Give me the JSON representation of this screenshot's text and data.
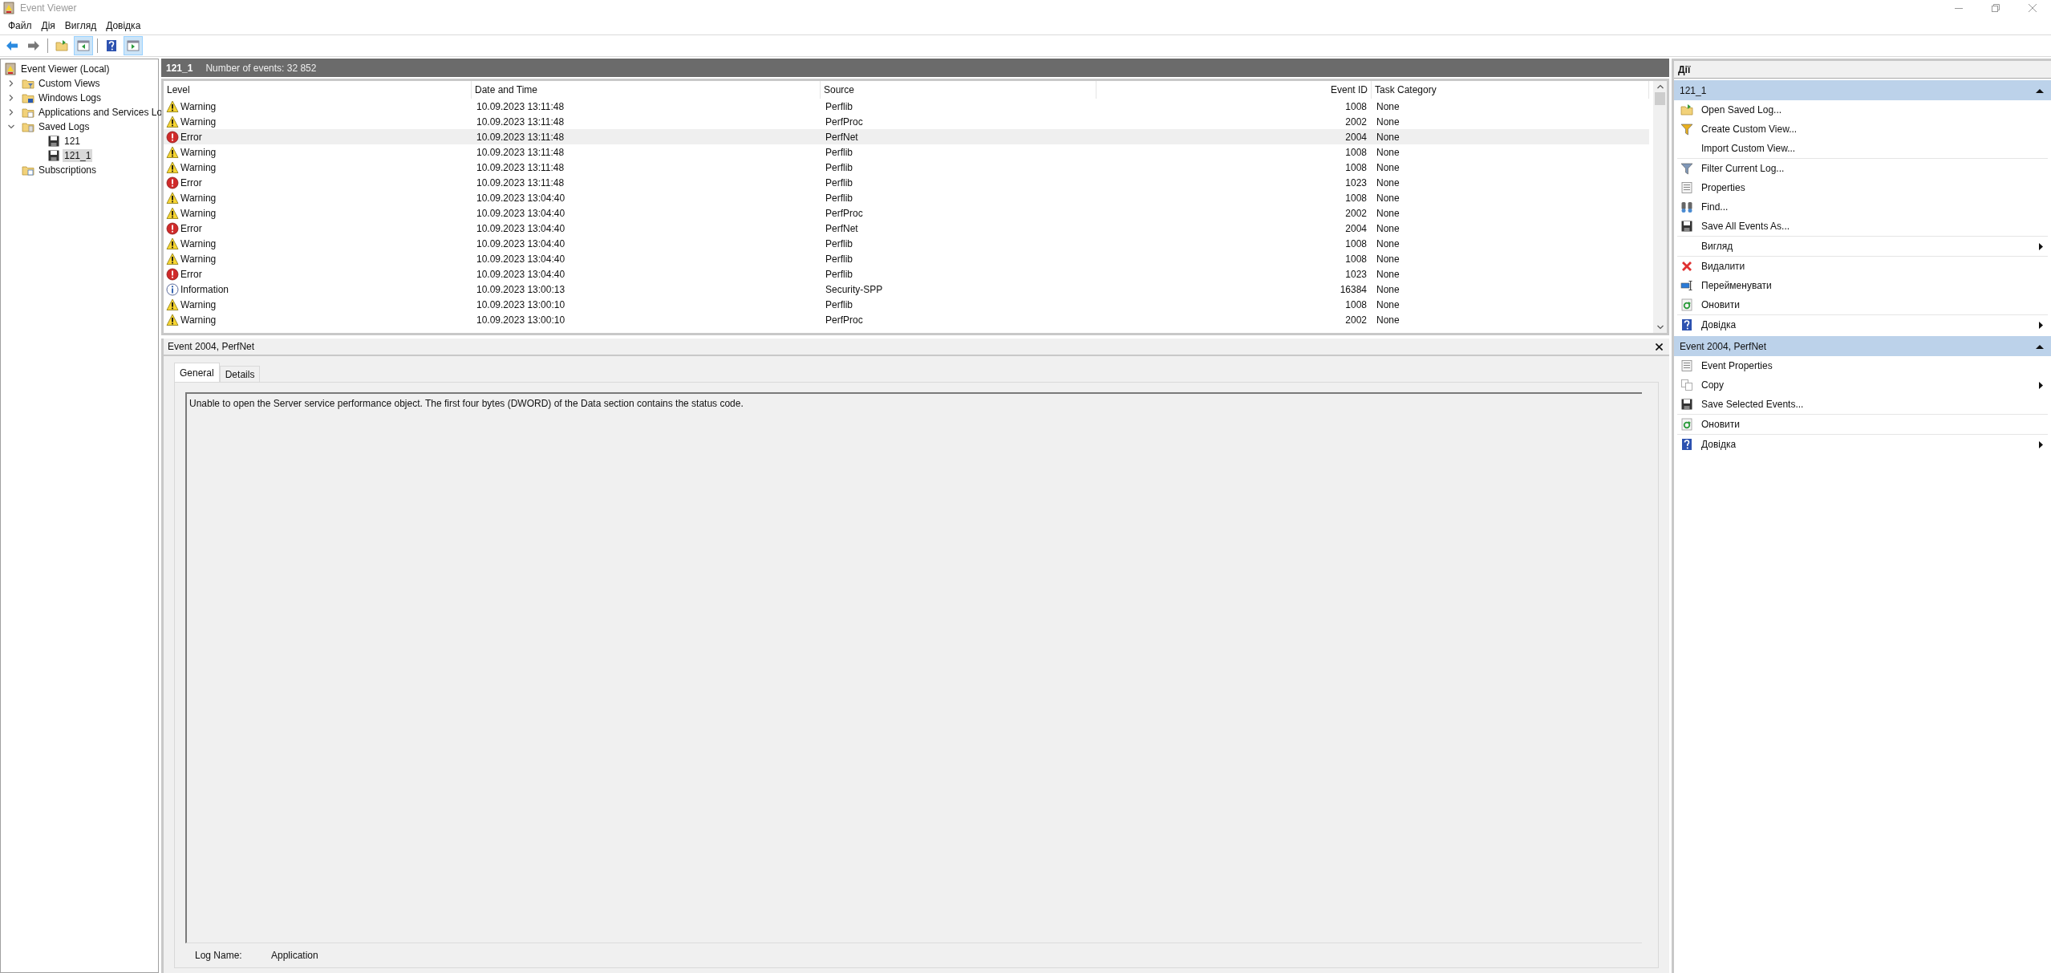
{
  "window": {
    "title": "Event Viewer"
  },
  "menu": [
    "Файл",
    "Дія",
    "Вигляд",
    "Довідка"
  ],
  "toolbar": [
    {
      "kind": "back",
      "pressed": false
    },
    {
      "kind": "forward",
      "pressed": false
    },
    {
      "kind": "separator"
    },
    {
      "kind": "folder-up",
      "pressed": false
    },
    {
      "kind": "pane-left",
      "pressed": true
    },
    {
      "kind": "separator"
    },
    {
      "kind": "help",
      "pressed": false
    },
    {
      "kind": "pane-right",
      "pressed": true
    }
  ],
  "tree": [
    {
      "label": "Event Viewer (Local)",
      "kind": "root",
      "selected": false,
      "children": [
        {
          "label": "Custom Views",
          "kind": "folder-filter",
          "expanded": false,
          "selected": false
        },
        {
          "label": "Windows Logs",
          "kind": "folder-windows",
          "expanded": false,
          "selected": false
        },
        {
          "label": "Applications and Services Lo",
          "kind": "folder-apps",
          "expanded": false,
          "selected": false
        },
        {
          "label": "Saved Logs",
          "kind": "folder-saved",
          "expanded": true,
          "selected": false,
          "children": [
            {
              "label": "121",
              "kind": "log",
              "selected": false
            },
            {
              "label": "121_1",
              "kind": "log",
              "selected": true
            }
          ]
        },
        {
          "label": "Subscriptions",
          "kind": "folder-subs",
          "selected": false
        }
      ]
    }
  ],
  "log_header": {
    "name": "121_1",
    "count": "Number of events: 32 852"
  },
  "table": {
    "columns": [
      "Level",
      "Date and Time",
      "Source",
      "Event ID",
      "Task Category"
    ],
    "rows": [
      {
        "kind": "warning",
        "level": "Warning",
        "date": "10.09.2023 13:11:48",
        "source": "Perflib",
        "event_id": "1008",
        "category": "None",
        "selected": false
      },
      {
        "kind": "warning",
        "level": "Warning",
        "date": "10.09.2023 13:11:48",
        "source": "PerfProc",
        "event_id": "2002",
        "category": "None",
        "selected": false
      },
      {
        "kind": "error",
        "level": "Error",
        "date": "10.09.2023 13:11:48",
        "source": "PerfNet",
        "event_id": "2004",
        "category": "None",
        "selected": true
      },
      {
        "kind": "warning",
        "level": "Warning",
        "date": "10.09.2023 13:11:48",
        "source": "Perflib",
        "event_id": "1008",
        "category": "None",
        "selected": false
      },
      {
        "kind": "warning",
        "level": "Warning",
        "date": "10.09.2023 13:11:48",
        "source": "Perflib",
        "event_id": "1008",
        "category": "None",
        "selected": false
      },
      {
        "kind": "error",
        "level": "Error",
        "date": "10.09.2023 13:11:48",
        "source": "Perflib",
        "event_id": "1023",
        "category": "None",
        "selected": false
      },
      {
        "kind": "warning",
        "level": "Warning",
        "date": "10.09.2023 13:04:40",
        "source": "Perflib",
        "event_id": "1008",
        "category": "None",
        "selected": false
      },
      {
        "kind": "warning",
        "level": "Warning",
        "date": "10.09.2023 13:04:40",
        "source": "PerfProc",
        "event_id": "2002",
        "category": "None",
        "selected": false
      },
      {
        "kind": "error",
        "level": "Error",
        "date": "10.09.2023 13:04:40",
        "source": "PerfNet",
        "event_id": "2004",
        "category": "None",
        "selected": false
      },
      {
        "kind": "warning",
        "level": "Warning",
        "date": "10.09.2023 13:04:40",
        "source": "Perflib",
        "event_id": "1008",
        "category": "None",
        "selected": false
      },
      {
        "kind": "warning",
        "level": "Warning",
        "date": "10.09.2023 13:04:40",
        "source": "Perflib",
        "event_id": "1008",
        "category": "None",
        "selected": false
      },
      {
        "kind": "error",
        "level": "Error",
        "date": "10.09.2023 13:04:40",
        "source": "Perflib",
        "event_id": "1023",
        "category": "None",
        "selected": false
      },
      {
        "kind": "information",
        "level": "Information",
        "date": "10.09.2023 13:00:13",
        "source": "Security-SPP",
        "event_id": "16384",
        "category": "None",
        "selected": false
      },
      {
        "kind": "warning",
        "level": "Warning",
        "date": "10.09.2023 13:00:10",
        "source": "Perflib",
        "event_id": "1008",
        "category": "None",
        "selected": false
      },
      {
        "kind": "warning",
        "level": "Warning",
        "date": "10.09.2023 13:00:10",
        "source": "PerfProc",
        "event_id": "2002",
        "category": "None",
        "selected": false
      }
    ]
  },
  "detail": {
    "title": "Event 2004, PerfNet",
    "tabs": [
      {
        "label": "General",
        "selected": true
      },
      {
        "label": "Details",
        "selected": false
      }
    ],
    "message": "Unable to open the Server service performance object. The first four bytes (DWORD) of the Data section contains the status code.",
    "fields": [
      {
        "label": "Log Name:",
        "value": "Application"
      }
    ]
  },
  "actions": {
    "title": "Дії",
    "sections": [
      {
        "title": "121_1",
        "expanded": true,
        "groups": [
          [
            {
              "label": "Open Saved Log...",
              "kind": "open",
              "submenu": false
            },
            {
              "label": "Create Custom View...",
              "kind": "funnel",
              "submenu": false
            },
            {
              "label": "Import Custom View...",
              "kind": "none",
              "submenu": false
            }
          ],
          [
            {
              "label": "Filter Current Log...",
              "kind": "filter",
              "submenu": false
            },
            {
              "label": "Properties",
              "kind": "properties",
              "submenu": false
            },
            {
              "label": "Find...",
              "kind": "find",
              "submenu": false
            },
            {
              "label": "Save All Events As...",
              "kind": "save",
              "submenu": false
            }
          ],
          [
            {
              "label": "Вигляд",
              "kind": "none",
              "submenu": true
            }
          ],
          [
            {
              "label": "Видалити",
              "kind": "delete",
              "submenu": false
            },
            {
              "label": "Перейменувати",
              "kind": "rename",
              "submenu": false
            },
            {
              "label": "Оновити",
              "kind": "refresh",
              "submenu": false
            }
          ],
          [
            {
              "label": "Довідка",
              "kind": "help",
              "submenu": true
            }
          ]
        ]
      },
      {
        "title": "Event 2004, PerfNet",
        "expanded": true,
        "groups": [
          [
            {
              "label": "Event Properties",
              "kind": "properties",
              "submenu": false
            },
            {
              "label": "Copy",
              "kind": "copy",
              "submenu": true
            },
            {
              "label": "Save Selected Events...",
              "kind": "save",
              "submenu": false
            }
          ],
          [
            {
              "label": "Оновити",
              "kind": "refresh",
              "submenu": false
            }
          ],
          [
            {
              "label": "Довідка",
              "kind": "help",
              "submenu": true
            }
          ]
        ]
      }
    ]
  }
}
